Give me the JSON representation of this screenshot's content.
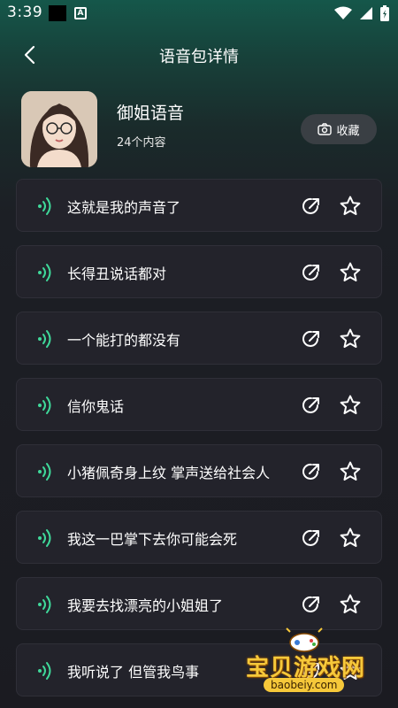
{
  "status_bar": {
    "time": "3:39",
    "a_icon_letter": "A"
  },
  "header": {
    "title": "语音包详情"
  },
  "pack": {
    "name": "御姐语音",
    "count": "24个内容",
    "favorite_label": "收藏"
  },
  "items": [
    {
      "label": "这就是我的声音了"
    },
    {
      "label": "长得丑说话都对"
    },
    {
      "label": "一个能打的都没有"
    },
    {
      "label": "信你鬼话"
    },
    {
      "label": "小猪佩奇身上纹 掌声送给社会人"
    },
    {
      "label": "我这一巴掌下去你可能会死"
    },
    {
      "label": "我要去找漂亮的小姐姐了"
    },
    {
      "label": "我听说了 但管我鸟事"
    }
  ],
  "watermark": {
    "brand": "宝贝游戏网",
    "url": "baobeiy.com"
  },
  "colors": {
    "accent_green": "#3fd99a",
    "item_bg": "#23232b",
    "button_bg": "#3a3f44"
  }
}
